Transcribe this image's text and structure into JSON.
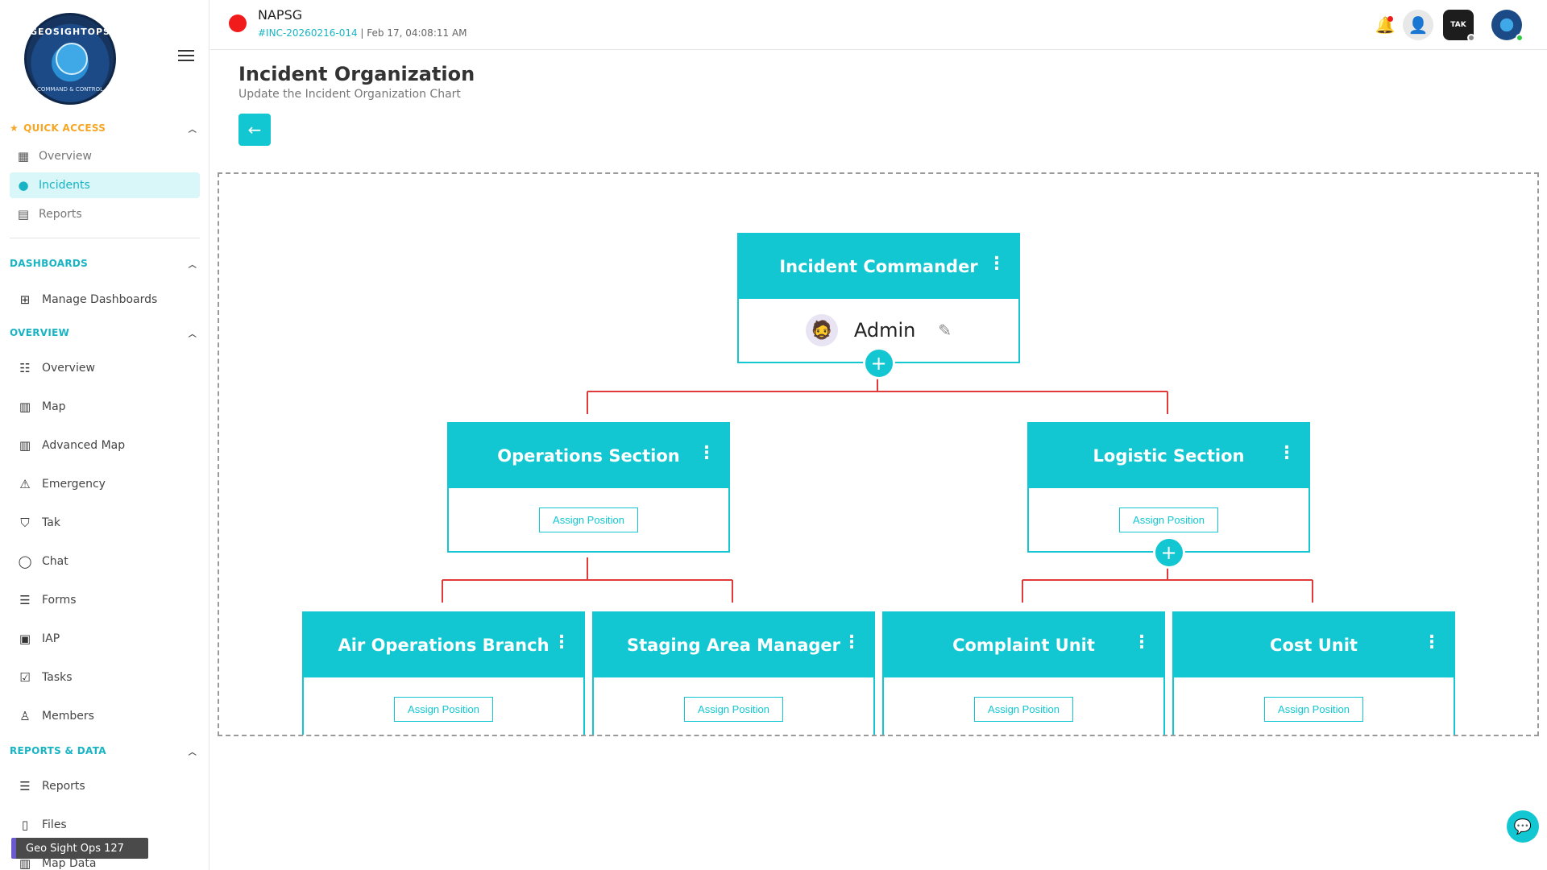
{
  "sidebar": {
    "logo_text": "GEOSIGHTOPS",
    "logo_subtext": "COMMAND & CONTROL",
    "quick_access": {
      "title": "QUICK ACCESS",
      "items": [
        {
          "label": "Overview",
          "icon": "dashboard-icon"
        },
        {
          "label": "Incidents",
          "icon": "alert-circle-icon",
          "active": true
        },
        {
          "label": "Reports",
          "icon": "document-icon"
        }
      ]
    },
    "dashboards": {
      "title": "DASHBOARDS",
      "items": [
        {
          "label": "Manage Dashboards",
          "icon": "dashboard-manage-icon"
        }
      ]
    },
    "overview": {
      "title": "OVERVIEW",
      "items": [
        {
          "label": "Overview",
          "icon": "grid-list-icon"
        },
        {
          "label": "Map",
          "icon": "map-icon"
        },
        {
          "label": "Advanced Map",
          "icon": "map-icon"
        },
        {
          "label": "Emergency",
          "icon": "siren-icon"
        },
        {
          "label": "Tak",
          "icon": "shield-icon"
        },
        {
          "label": "Chat",
          "icon": "chat-bubble-icon"
        },
        {
          "label": "Forms",
          "icon": "list-icon"
        },
        {
          "label": "IAP",
          "icon": "clipboard-icon"
        },
        {
          "label": "Tasks",
          "icon": "calendar-check-icon"
        },
        {
          "label": "Members",
          "icon": "person-icon"
        }
      ]
    },
    "reports_data": {
      "title": "REPORTS & DATA",
      "items": [
        {
          "label": "Reports",
          "icon": "list-icon"
        },
        {
          "label": "Files",
          "icon": "file-icon"
        },
        {
          "label": "Map Data",
          "icon": "map-icon"
        }
      ]
    },
    "tooltip": "Geo Sight Ops 127"
  },
  "topbar": {
    "org": "NAPSG",
    "incident_code": "#INC-20260216-014",
    "incident_time": "| Feb 17, 04:08:11 AM",
    "tak_label": "TAK"
  },
  "page": {
    "title": "Incident Organization",
    "subtitle": "Update the Incident Organization Chart"
  },
  "org_chart": {
    "commander": {
      "title": "Incident Commander",
      "assignee": "Admin"
    },
    "sections": [
      {
        "title": "Operations Section",
        "button": "Assign Position"
      },
      {
        "title": "Logistic Section",
        "button": "Assign Position"
      }
    ],
    "units": [
      {
        "title": "Air Operations Branch",
        "button": "Assign Position"
      },
      {
        "title": "Staging Area Manager",
        "button": "Assign Position"
      },
      {
        "title": "Complaint Unit",
        "button": "Assign Position"
      },
      {
        "title": "Cost Unit",
        "button": "Assign Position"
      }
    ]
  },
  "colors": {
    "accent": "#12c7d1",
    "quick_access": "#f5a623",
    "section_header": "#18b4c4",
    "connector": "#e03a3a",
    "record": "#f21b1b"
  }
}
